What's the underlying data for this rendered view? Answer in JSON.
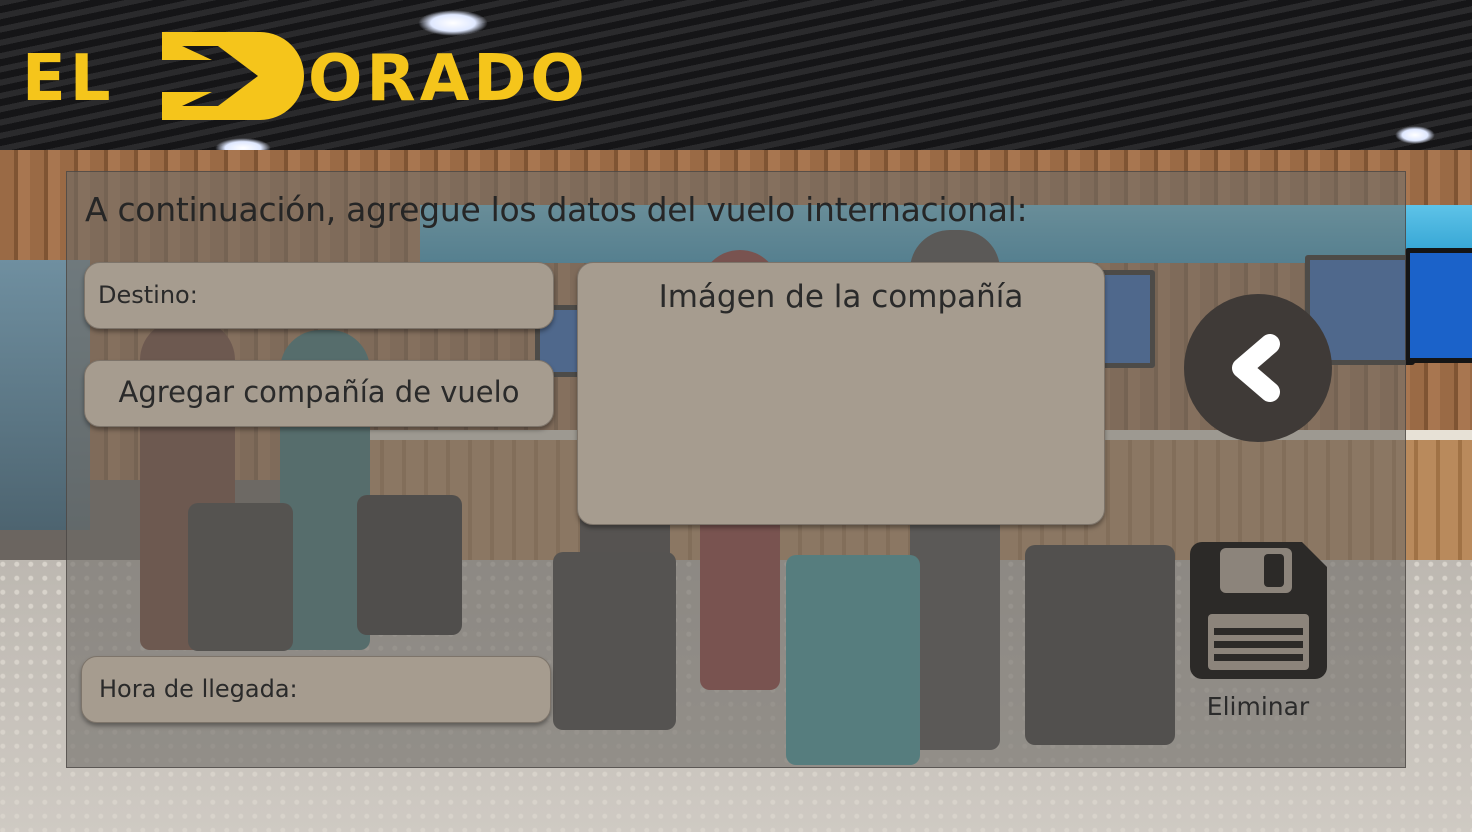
{
  "logo": {
    "text_left": "EL",
    "text_right": "ORADO",
    "color": "#f5c51b"
  },
  "form": {
    "heading": "A continuación, agregue los datos del vuelo internacional:",
    "destino_label": "Destino:",
    "add_company_label": "Agregar compañía de vuelo",
    "company_image_label": "Imágen de la compañía",
    "arrival_label": "Hora de llegada:"
  },
  "actions": {
    "back_icon": "chevron-left-icon",
    "save_icon": "floppy-disk-icon",
    "eliminar_label": "Eliminar"
  },
  "colors": {
    "field_bg": "#a69c8f",
    "button_dark": "#3f3a37",
    "accent_yellow": "#f5c51b"
  }
}
